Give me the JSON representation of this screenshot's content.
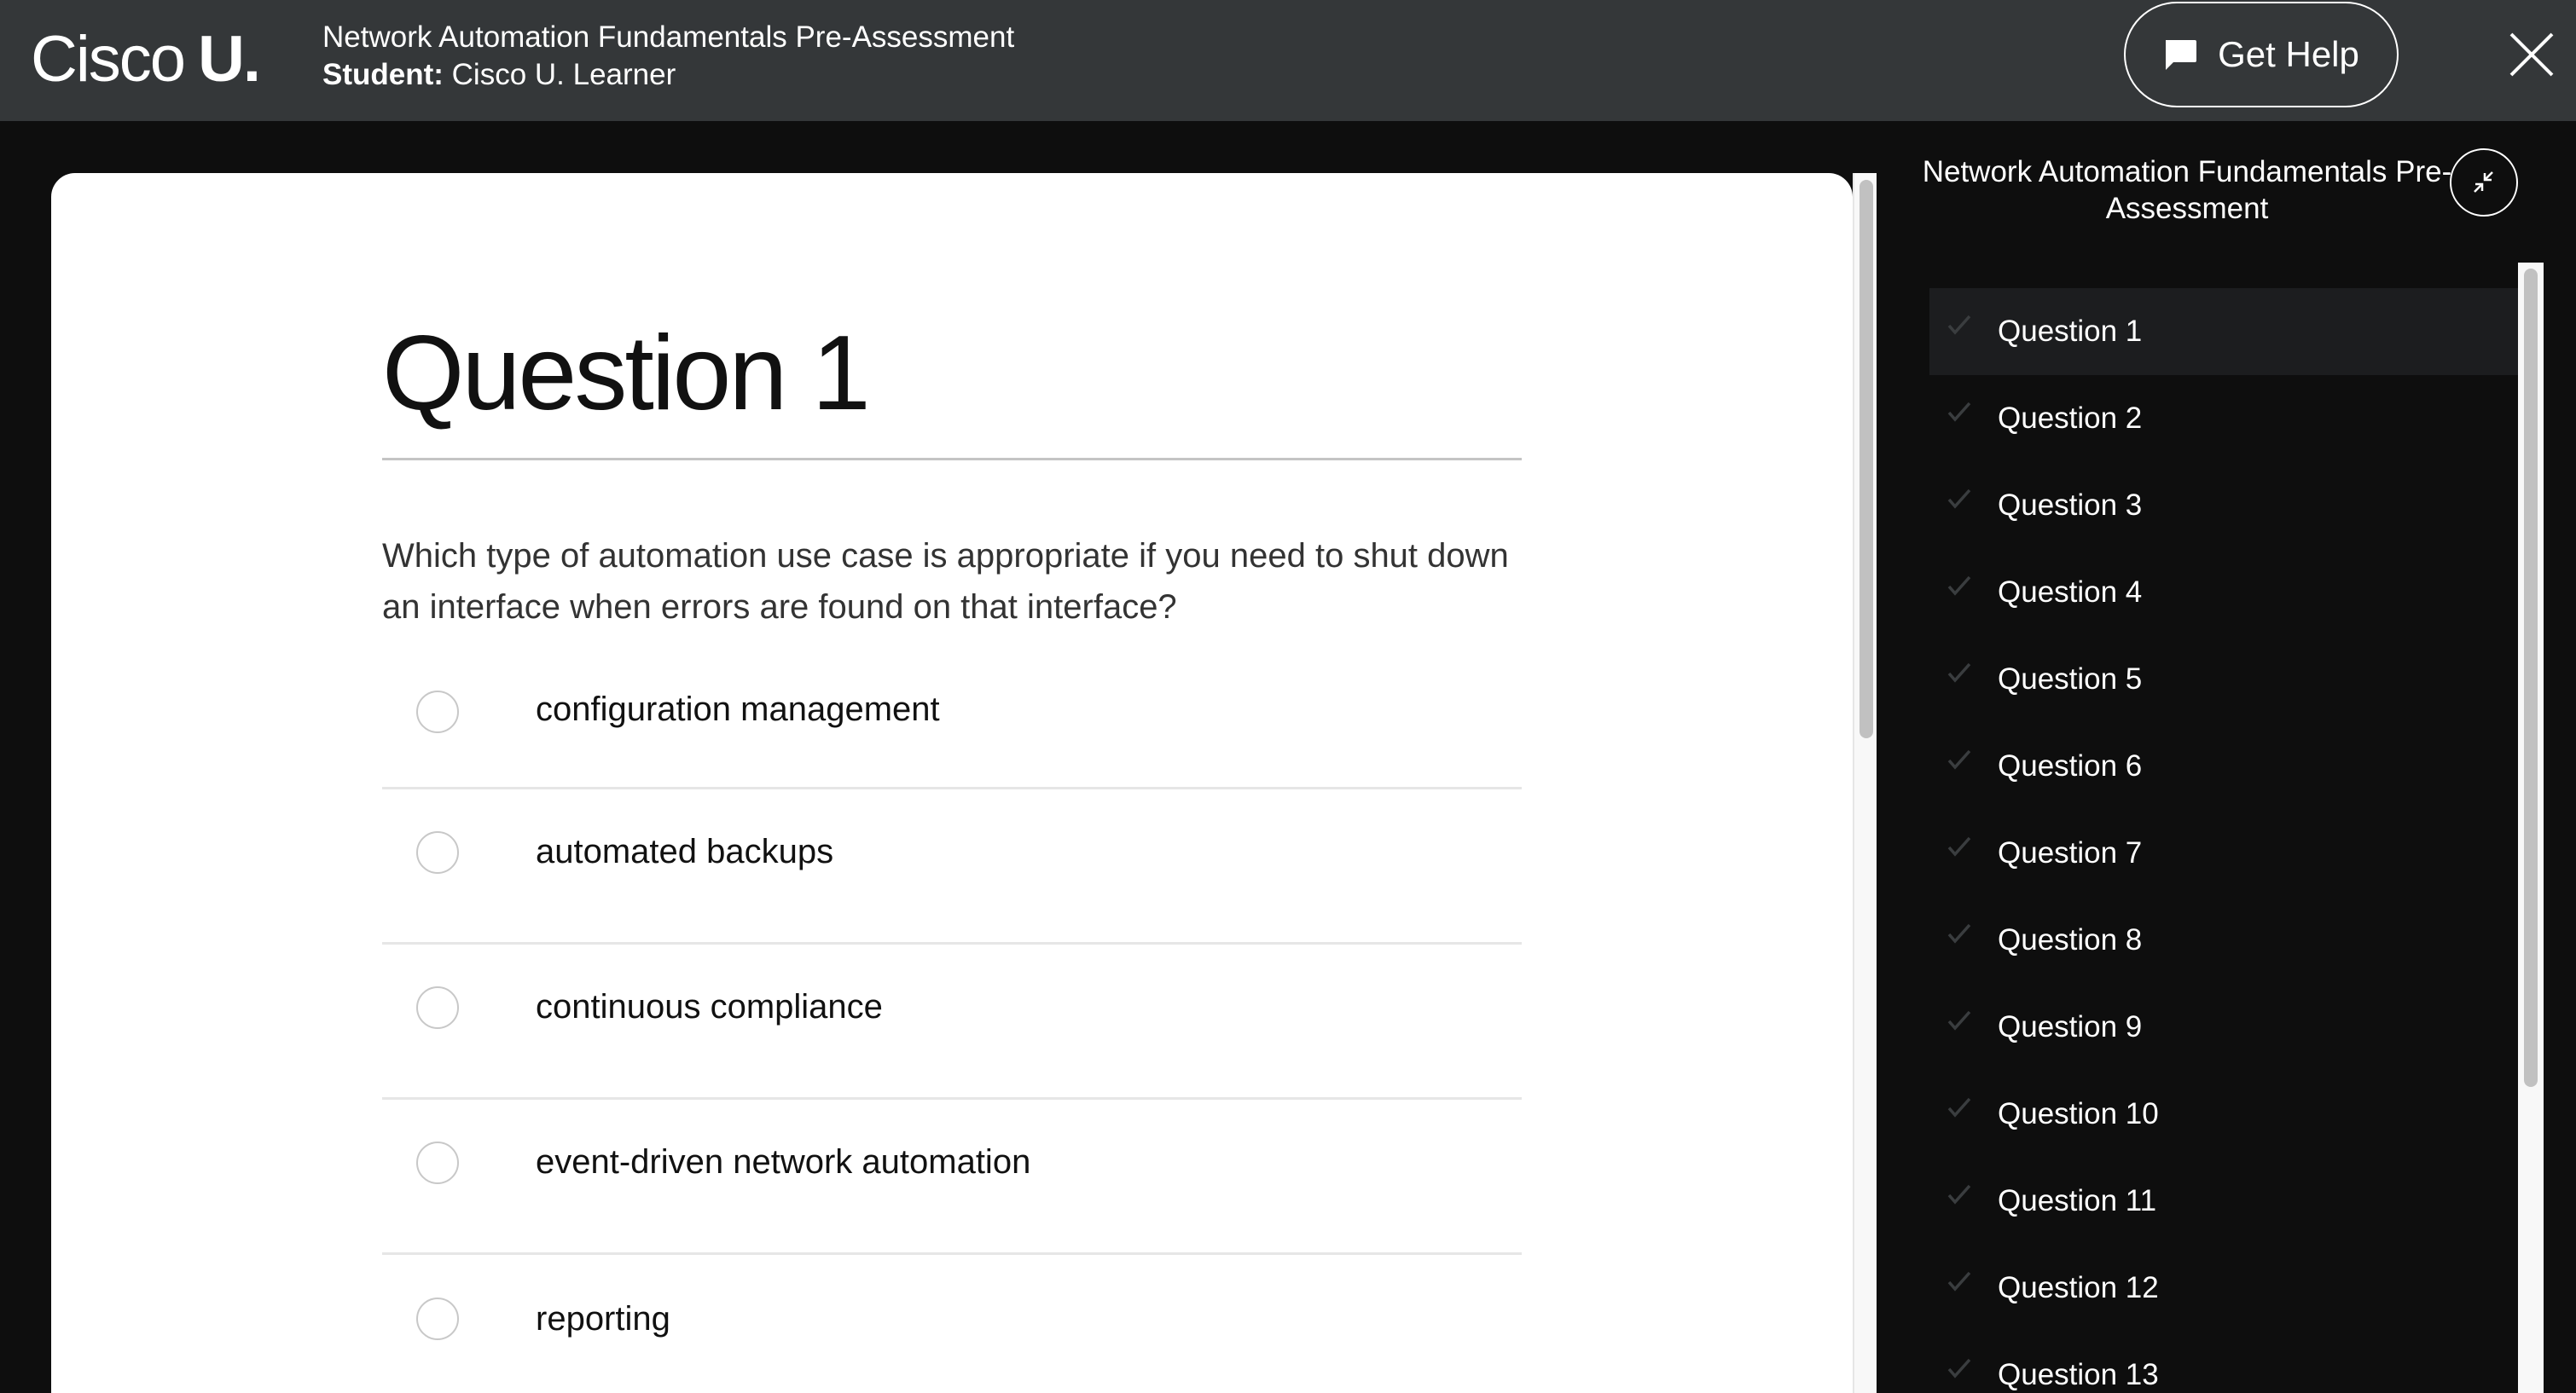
{
  "header": {
    "logo_light": "Cisco",
    "logo_bold": "U.",
    "course_title": "Network Automation Fundamentals Pre-Assessment",
    "student_label": "Student:",
    "student_name": "Cisco U. Learner",
    "get_help_label": "Get Help",
    "get_help_icon": "chat-bubble-icon",
    "close_icon": "close-icon"
  },
  "question": {
    "title": "Question 1",
    "text": "Which type of automation use case is appropriate if you need to shut down an interface when errors are found on that interface?",
    "options": [
      {
        "label": "configuration management",
        "selected": false
      },
      {
        "label": "automated backups",
        "selected": false
      },
      {
        "label": "continuous compliance",
        "selected": false
      },
      {
        "label": "event-driven network automation",
        "selected": false
      },
      {
        "label": "reporting",
        "selected": false
      }
    ]
  },
  "sidebar": {
    "title": "Network Automation Fundamentals Pre-Assessment",
    "collapse_icon": "collapse-icon",
    "active_index": 0,
    "items": [
      {
        "label": "Question 1"
      },
      {
        "label": "Question 2"
      },
      {
        "label": "Question 3"
      },
      {
        "label": "Question 4"
      },
      {
        "label": "Question 5"
      },
      {
        "label": "Question 6"
      },
      {
        "label": "Question 7"
      },
      {
        "label": "Question 8"
      },
      {
        "label": "Question 9"
      },
      {
        "label": "Question 10"
      },
      {
        "label": "Question 11"
      },
      {
        "label": "Question 12"
      },
      {
        "label": "Question 13"
      }
    ]
  },
  "colors": {
    "header_bg": "#343739",
    "page_bg": "#0e0e0e",
    "active_item_bg": "#1c1d1f",
    "check_color": "#3a3d3f"
  }
}
